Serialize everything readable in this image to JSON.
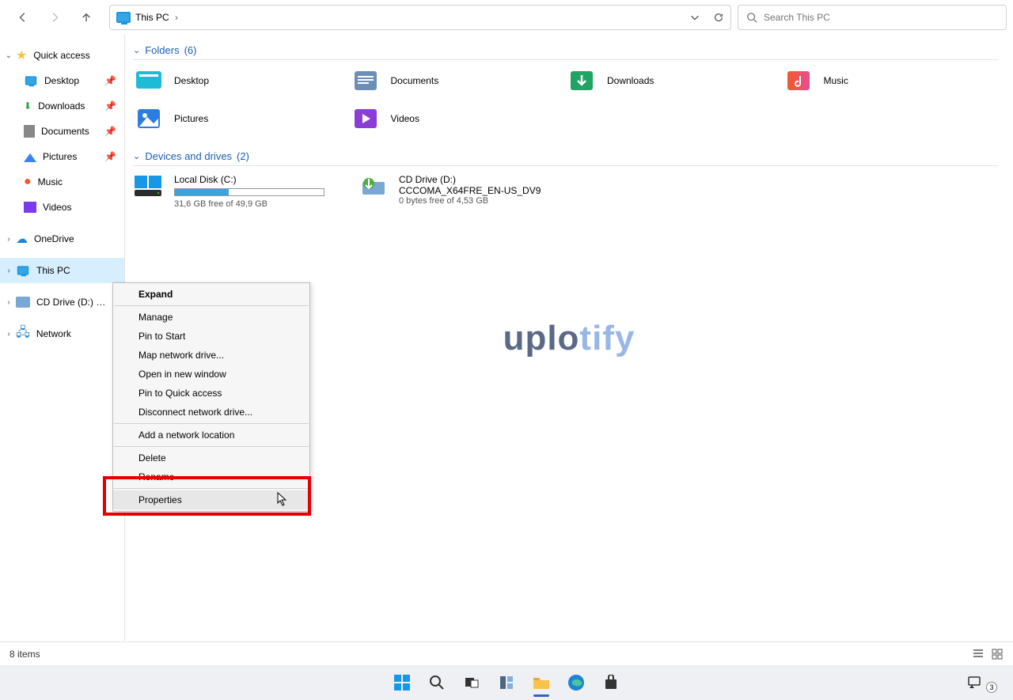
{
  "breadcrumb": {
    "location": "This PC"
  },
  "search": {
    "placeholder": "Search This PC"
  },
  "sidebar": {
    "quick_access": "Quick access",
    "items": [
      "Desktop",
      "Downloads",
      "Documents",
      "Pictures",
      "Music",
      "Videos"
    ],
    "onedrive": "OneDrive",
    "this_pc": "This PC",
    "cd_drive": "CD Drive (D:) CCC",
    "network": "Network"
  },
  "sections": {
    "folders": {
      "title": "Folders",
      "count": "(6)"
    },
    "drives": {
      "title": "Devices and drives",
      "count": "(2)"
    }
  },
  "folders": [
    {
      "name": "Desktop",
      "icon": "desktop"
    },
    {
      "name": "Documents",
      "icon": "documents"
    },
    {
      "name": "Downloads",
      "icon": "downloads"
    },
    {
      "name": "Music",
      "icon": "music"
    },
    {
      "name": "Pictures",
      "icon": "pictures"
    },
    {
      "name": "Videos",
      "icon": "videos"
    }
  ],
  "drives": [
    {
      "name": "Local Disk (C:)",
      "free_text": "31,6 GB free of 49,9 GB",
      "used_pct": 36
    },
    {
      "name": "CD Drive (D:)",
      "label": "CCCOMA_X64FRE_EN-US_DV9",
      "free_text": "0 bytes free of 4,53 GB"
    }
  ],
  "context_menu": {
    "items": [
      {
        "label": "Expand",
        "bold": true
      },
      {
        "sep": true
      },
      {
        "label": "Manage"
      },
      {
        "label": "Pin to Start"
      },
      {
        "label": "Map network drive..."
      },
      {
        "label": "Open in new window"
      },
      {
        "label": "Pin to Quick access"
      },
      {
        "label": "Disconnect network drive..."
      },
      {
        "sep": true
      },
      {
        "label": "Add a network location"
      },
      {
        "sep": true
      },
      {
        "label": "Delete"
      },
      {
        "label": "Rename"
      },
      {
        "sep": true
      },
      {
        "label": "Properties",
        "hover": true
      }
    ]
  },
  "watermark": {
    "part1": "uplo",
    "part2": "tify"
  },
  "status": {
    "items_text": "8 items"
  },
  "tray": {
    "badge": "3"
  }
}
